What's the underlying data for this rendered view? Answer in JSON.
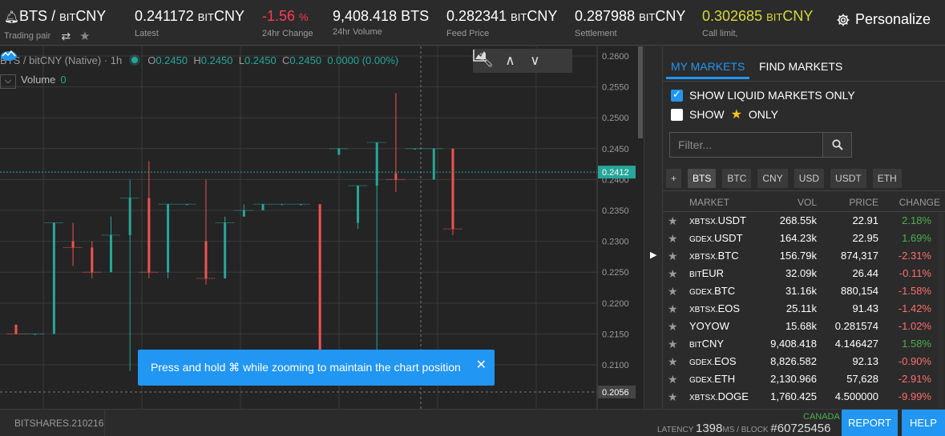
{
  "header": {
    "pair": {
      "base": "BTS",
      "sep": " / ",
      "quote_prefix": "BIT",
      "quote": "CNY",
      "label": "Trading pair"
    },
    "stats": [
      {
        "value": "0.241172",
        "unit_prefix": "BIT",
        "unit": "CNY",
        "label": "Latest",
        "color": "#ffffff"
      },
      {
        "value": "-1.56",
        "unit": "%",
        "label": "24hr Change",
        "color": "#ff3b55"
      },
      {
        "value": "9,408.418",
        "unit": "BTS",
        "label": "24hr Volume",
        "color": "#ffffff"
      },
      {
        "value": "0.282341",
        "unit_prefix": "BIT",
        "unit": "CNY",
        "label": "Feed Price",
        "color": "#ffffff"
      },
      {
        "value": "0.287988",
        "unit_prefix": "BIT",
        "unit": "CNY",
        "label": "Settlement",
        "color": "#ffffff"
      },
      {
        "value": "0.302685",
        "unit_prefix": "BIT",
        "unit": "CNY",
        "label": "Call limit,",
        "color": "#d9d93a"
      }
    ],
    "personalize": "Personalize"
  },
  "chart": {
    "legend": {
      "symbol": "BTS / bitCNY (Native) · 1h",
      "o": "0.2450",
      "h": "0.2450",
      "l": "0.2450",
      "c": "0.2450",
      "chg": "0.0000 (0.00%)"
    },
    "volume": {
      "label": "Volume",
      "value": "0"
    },
    "y_ticks": [
      "0.2600",
      "0.2550",
      "0.2500",
      "0.2450",
      "0.2400",
      "0.2350",
      "0.2300",
      "0.2250",
      "0.2200",
      "0.2150",
      "0.2100",
      "0.2056"
    ],
    "current_price": "0.2412",
    "low_marker": "0.2056",
    "toast": "Press and hold ⌘ while zooming to maintain the chart position",
    "colors": {
      "up": "#26a69a",
      "down": "#ef5350",
      "bg": "#242424"
    }
  },
  "chart_data": {
    "type": "candlestick",
    "ylim": [
      0.2056,
      0.26
    ],
    "candles": [
      {
        "o": 0.2165,
        "h": 0.2165,
        "l": 0.215,
        "c": 0.215
      },
      {
        "o": 0.215,
        "h": 0.215,
        "l": 0.215,
        "c": 0.215
      },
      {
        "o": 0.215,
        "h": 0.233,
        "l": 0.215,
        "c": 0.233
      },
      {
        "o": 0.23,
        "h": 0.233,
        "l": 0.226,
        "c": 0.229
      },
      {
        "o": 0.229,
        "h": 0.23,
        "l": 0.224,
        "c": 0.225
      },
      {
        "o": 0.225,
        "h": 0.234,
        "l": 0.225,
        "c": 0.231
      },
      {
        "o": 0.231,
        "h": 0.24,
        "l": 0.209,
        "c": 0.237
      },
      {
        "o": 0.237,
        "h": 0.243,
        "l": 0.224,
        "c": 0.225
      },
      {
        "o": 0.225,
        "h": 0.236,
        "l": 0.224,
        "c": 0.236
      },
      {
        "o": 0.236,
        "h": 0.236,
        "l": 0.236,
        "c": 0.236
      },
      {
        "o": 0.23,
        "h": 0.24,
        "l": 0.223,
        "c": 0.224
      },
      {
        "o": 0.224,
        "h": 0.234,
        "l": 0.224,
        "c": 0.233
      },
      {
        "o": 0.234,
        "h": 0.236,
        "l": 0.234,
        "c": 0.235
      },
      {
        "o": 0.235,
        "h": 0.236,
        "l": 0.235,
        "c": 0.236
      },
      {
        "o": 0.236,
        "h": 0.236,
        "l": 0.236,
        "c": 0.236
      },
      {
        "o": 0.236,
        "h": 0.236,
        "l": 0.236,
        "c": 0.236
      },
      {
        "o": 0.236,
        "h": 0.236,
        "l": 0.209,
        "c": 0.21
      },
      {
        "o": 0.244,
        "h": 0.245,
        "l": 0.244,
        "c": 0.245
      },
      {
        "o": 0.233,
        "h": 0.238,
        "l": 0.232,
        "c": 0.239
      },
      {
        "o": 0.239,
        "h": 0.246,
        "l": 0.209,
        "c": 0.246
      },
      {
        "o": 0.241,
        "h": 0.254,
        "l": 0.238,
        "c": 0.24
      },
      {
        "o": 0.245,
        "h": 0.245,
        "l": 0.245,
        "c": 0.245
      },
      {
        "o": 0.24,
        "h": 0.245,
        "l": 0.24,
        "c": 0.245
      },
      {
        "o": 0.245,
        "h": 0.245,
        "l": 0.231,
        "c": 0.232
      }
    ]
  },
  "sidebar": {
    "tabs": [
      "MY MARKETS",
      "FIND MARKETS"
    ],
    "liquid_only": "SHOW LIQUID MARKETS ONLY",
    "show": "SHOW",
    "only": "ONLY",
    "filter_placeholder": "Filter...",
    "quote_tabs": [
      "+",
      "BTS",
      "BTC",
      "CNY",
      "USD",
      "USDT",
      "ETH"
    ],
    "columns": {
      "market": "MARKET",
      "vol": "VOL",
      "price": "PRICE",
      "change": "CHANGE"
    },
    "markets": [
      {
        "prefix": "XBTSX.",
        "name": "USDT",
        "vol": "268.55k",
        "price": "22.91",
        "change": "2.18%",
        "dir": "pos"
      },
      {
        "prefix": "GDEX.",
        "name": "USDT",
        "vol": "164.23k",
        "price": "22.95",
        "change": "1.69%",
        "dir": "pos"
      },
      {
        "prefix": "XBTSX.",
        "name": "BTC",
        "vol": "156.79k",
        "price": "874,317",
        "change": "-2.31%",
        "dir": "neg"
      },
      {
        "prefix": "BIT",
        "name": "EUR",
        "vol": "32.09k",
        "price": "26.44",
        "change": "-0.11%",
        "dir": "neg"
      },
      {
        "prefix": "GDEX.",
        "name": "BTC",
        "vol": "31.16k",
        "price": "880,154",
        "change": "-1.58%",
        "dir": "neg"
      },
      {
        "prefix": "XBTSX.",
        "name": "EOS",
        "vol": "25.11k",
        "price": "91.43",
        "change": "-1.42%",
        "dir": "neg"
      },
      {
        "prefix": "",
        "name": "YOYOW",
        "vol": "15.68k",
        "price": "0.281574",
        "change": "-1.02%",
        "dir": "neg"
      },
      {
        "prefix": "BIT",
        "name": "CNY",
        "vol": "9,408.418",
        "price": "4.146427",
        "change": "1.58%",
        "dir": "pos"
      },
      {
        "prefix": "GDEX.",
        "name": "EOS",
        "vol": "8,826.582",
        "price": "92.13",
        "change": "-0.90%",
        "dir": "neg"
      },
      {
        "prefix": "GDEX.",
        "name": "ETH",
        "vol": "2,130.966",
        "price": "57,628",
        "change": "-2.91%",
        "dir": "neg"
      },
      {
        "prefix": "XBTSX.",
        "name": "DOGE",
        "vol": "1,760.425",
        "price": "4.500000",
        "change": "-9.99%",
        "dir": "neg"
      }
    ]
  },
  "footer": {
    "version": "BITSHARES.210216",
    "latency_label": "LATENCY",
    "latency_value": "1398",
    "latency_unit": "MS / BLOCK",
    "block": "#60725456",
    "region": "CANADA",
    "report": "REPORT",
    "help": "HELP"
  }
}
